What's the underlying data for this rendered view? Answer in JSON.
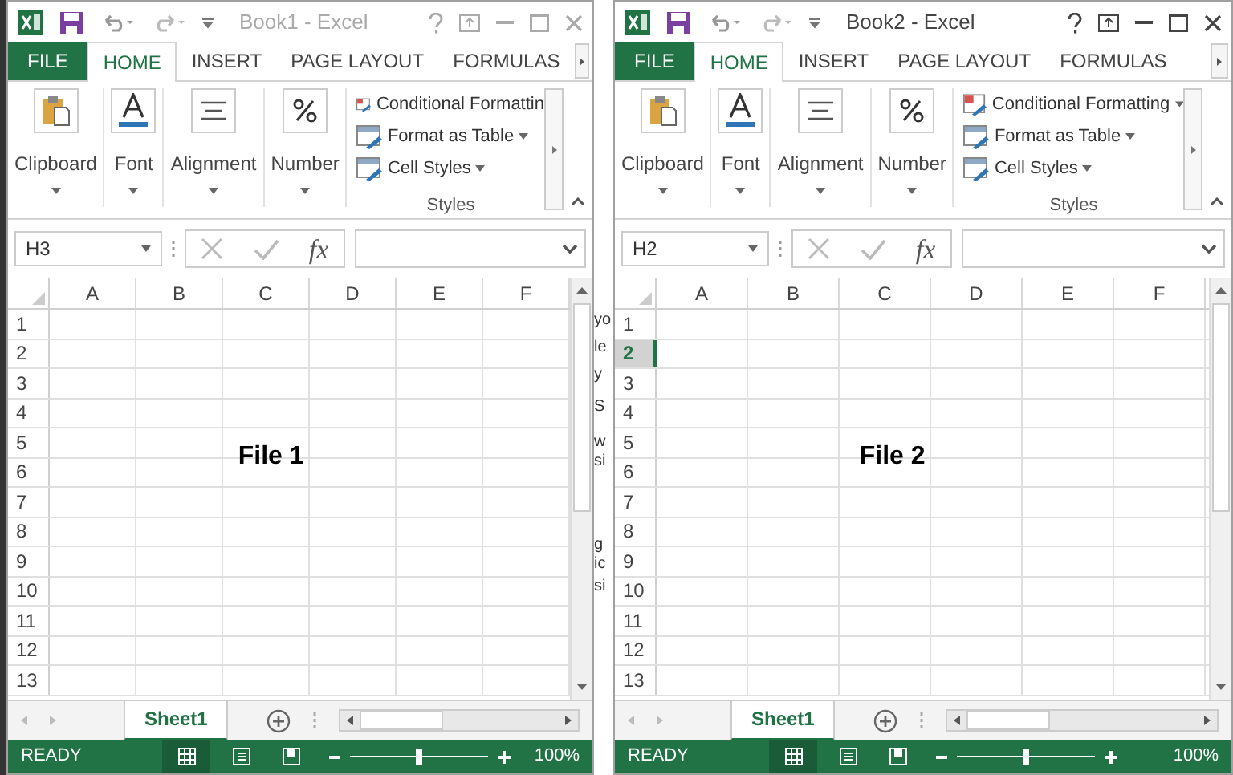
{
  "windows": [
    {
      "title": "Book1 - Excel",
      "active": false,
      "tabs": [
        {
          "label": "FILE",
          "kind": "file",
          "selected": false
        },
        {
          "label": "HOME",
          "kind": "tab",
          "selected": true
        },
        {
          "label": "INSERT",
          "kind": "tab",
          "selected": false
        },
        {
          "label": "PAGE LAYOUT",
          "kind": "tab",
          "selected": false
        },
        {
          "label": "FORMULAS",
          "kind": "tab",
          "selected": false
        }
      ],
      "ribbon_groups": [
        {
          "label": "Clipboard"
        },
        {
          "label": "Font"
        },
        {
          "label": "Alignment"
        },
        {
          "label": "Number"
        }
      ],
      "styles_group": {
        "label": "Styles",
        "items": [
          {
            "label": "Conditional Formattin",
            "caret": false
          },
          {
            "label": "Format as Table",
            "caret": true
          },
          {
            "label": "Cell Styles",
            "caret": true
          }
        ]
      },
      "name_box": "H3",
      "fx": "fx",
      "columns": [
        "A",
        "B",
        "C",
        "D",
        "E",
        "F"
      ],
      "rows": [
        {
          "label": "1",
          "selected": false
        },
        {
          "label": "2",
          "selected": false
        },
        {
          "label": "3",
          "selected": false
        },
        {
          "label": "4",
          "selected": false
        },
        {
          "label": "5",
          "selected": false
        },
        {
          "label": "6",
          "selected": false
        },
        {
          "label": "7",
          "selected": false
        },
        {
          "label": "8",
          "selected": false
        },
        {
          "label": "9",
          "selected": false
        },
        {
          "label": "10",
          "selected": false
        },
        {
          "label": "11",
          "selected": false
        },
        {
          "label": "12",
          "selected": false
        },
        {
          "label": "13",
          "selected": false
        }
      ],
      "overlay_label": "File 1",
      "sheet_tabs": [
        {
          "label": "Sheet1",
          "selected": true
        }
      ],
      "status": "READY",
      "zoom": {
        "label": "100%",
        "level": 0.5
      }
    },
    {
      "title": "Book2 - Excel",
      "active": true,
      "tabs": [
        {
          "label": "FILE",
          "kind": "file",
          "selected": false
        },
        {
          "label": "HOME",
          "kind": "tab",
          "selected": true
        },
        {
          "label": "INSERT",
          "kind": "tab",
          "selected": false
        },
        {
          "label": "PAGE LAYOUT",
          "kind": "tab",
          "selected": false
        },
        {
          "label": "FORMULAS",
          "kind": "tab",
          "selected": false
        }
      ],
      "ribbon_groups": [
        {
          "label": "Clipboard"
        },
        {
          "label": "Font"
        },
        {
          "label": "Alignment"
        },
        {
          "label": "Number"
        }
      ],
      "styles_group": {
        "label": "Styles",
        "items": [
          {
            "label": "Conditional Formatting",
            "caret": true
          },
          {
            "label": "Format as Table",
            "caret": true
          },
          {
            "label": "Cell Styles",
            "caret": true
          }
        ]
      },
      "name_box": "H2",
      "fx": "fx",
      "columns": [
        "A",
        "B",
        "C",
        "D",
        "E",
        "F"
      ],
      "rows": [
        {
          "label": "1",
          "selected": false
        },
        {
          "label": "2",
          "selected": true
        },
        {
          "label": "3",
          "selected": false
        },
        {
          "label": "4",
          "selected": false
        },
        {
          "label": "5",
          "selected": false
        },
        {
          "label": "6",
          "selected": false
        },
        {
          "label": "7",
          "selected": false
        },
        {
          "label": "8",
          "selected": false
        },
        {
          "label": "9",
          "selected": false
        },
        {
          "label": "10",
          "selected": false
        },
        {
          "label": "11",
          "selected": false
        },
        {
          "label": "12",
          "selected": false
        },
        {
          "label": "13",
          "selected": false
        }
      ],
      "overlay_label": "File 2",
      "sheet_tabs": [
        {
          "label": "Sheet1",
          "selected": true
        }
      ],
      "status": "READY",
      "zoom": {
        "label": "100%",
        "level": 0.5
      }
    }
  ],
  "background_fragments": [
    "yo",
    "le",
    "y",
    "S",
    "w",
    "si",
    "g",
    "ic",
    "si"
  ]
}
